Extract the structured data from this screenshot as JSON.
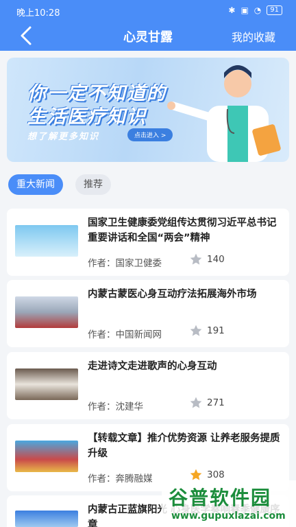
{
  "status": {
    "time": "晚上10:28",
    "icons": [
      "bluetooth-icon",
      "sim-icon",
      "wifi-icon"
    ],
    "battery": "91"
  },
  "nav": {
    "title": "心灵甘露",
    "right": "我的收藏"
  },
  "banner": {
    "line1": "你一定不知道的",
    "line2": "生活医疗知识",
    "sub": "想了解更多知识",
    "button": "点击进入 >"
  },
  "tabs": [
    {
      "label": "重大新闻",
      "active": true
    },
    {
      "label": "推荐",
      "active": false
    }
  ],
  "articles": [
    {
      "title": "国家卫生健康委党组传达贯彻习近平总书记重要讲话和全国“两会”精神",
      "author": "作者：国家卫健委",
      "count": "140",
      "starred": false
    },
    {
      "title": "内蒙古蒙医心身互动疗法拓展海外市场",
      "author": "作者：中国新闻网",
      "count": "191",
      "starred": false
    },
    {
      "title": "走进诗文走进歌声的心身互动",
      "author": "作者：沈建华",
      "count": "271",
      "starred": false
    },
    {
      "title": "【转载文章】推介优势资源 让养老服务提质升级",
      "author": "作者：奔腾融媒",
      "count": "308",
      "starred": true
    },
    {
      "title": "内蒙古正蓝旗阳光 心身医学奏响春季健康序章",
      "author": "",
      "count": "",
      "starred": false
    }
  ],
  "watermark": {
    "name": "谷普软件园",
    "url": "www.gupuxlazai.com"
  },
  "colors": {
    "accent": "#4a8df8",
    "star_on": "#f5a623",
    "star_off": "#b8bcc4"
  }
}
